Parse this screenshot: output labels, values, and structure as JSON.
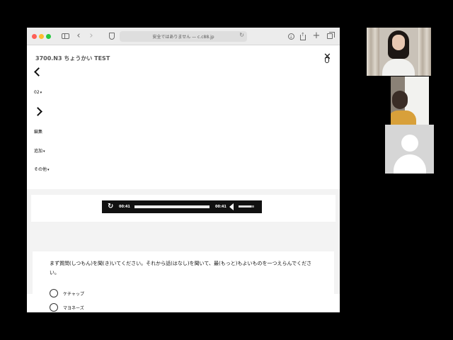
{
  "browser": {
    "url_text": "安全ではありません — c.c88.jp",
    "reload_glyph": "↻",
    "back_glyph": "‹",
    "forward_glyph": "›",
    "new_tab_glyph": "+"
  },
  "page": {
    "title": "3700.N3 ちょうかい TEST",
    "close_glyph": "✕",
    "menu": {
      "page_select": "02",
      "edit": "編集",
      "add": "追加",
      "other": "その他",
      "caret": "▾"
    }
  },
  "player": {
    "replay_glyph": "↻",
    "current_time": "00:41",
    "duration": "00:41",
    "progress": 1.0,
    "volume": 0.8
  },
  "question": {
    "text": "まず質問(しつもん)を聞(き)いてください。それから話(はなし)を聞いて、最(もっと)もよいものを一つえらんでください。",
    "options": [
      "ケチャップ",
      "マヨネーズ"
    ]
  },
  "icons": {
    "sidebar": "sidebar-icon",
    "shield": "shield-icon",
    "download": "download-icon",
    "share": "share-icon",
    "tabs": "tab-overview-icon",
    "volume": "volume-icon",
    "avatar": "person-avatar-icon"
  },
  "colors": {
    "traffic_red": "#fe5f57",
    "traffic_yellow": "#febc2e",
    "traffic_green": "#28c840",
    "player_bg": "#111111",
    "page_gray": "#f3f3f3"
  }
}
